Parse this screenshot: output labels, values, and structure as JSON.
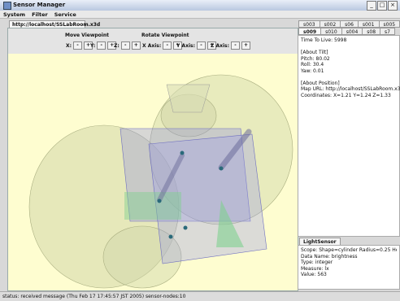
{
  "window": {
    "title": "Sensor Manager",
    "min_label": "_",
    "max_label": "□",
    "close_label": "×"
  },
  "menu": {
    "items": [
      "System",
      "Filter",
      "Service"
    ]
  },
  "viewer_tab": "http://localhost/SSLabRoom.x3d",
  "move_viewpoint": {
    "title": "Move Viewpoint",
    "axes": [
      "X:",
      "Y:",
      "Z:"
    ],
    "minus": "-",
    "plus": "+"
  },
  "rotate_viewpoint": {
    "title": "Rotate Viewpoint",
    "axes": [
      "X Axis:",
      "Y Axis:",
      "Z Axis:"
    ],
    "minus": "-",
    "plus": "+"
  },
  "sensor_tabs_row1": [
    "s003",
    "s002",
    "s06",
    "s001",
    "s005"
  ],
  "sensor_tabs_row2": [
    "s009",
    "s010",
    "s004",
    "s08",
    "s7"
  ],
  "active_sensor_tab": "s009",
  "info": {
    "ttl": "Time To Live: 5998",
    "tilt_header": "[About Tilt]",
    "pitch": "Pitch: 80.02",
    "roll": "Roll: 30.4",
    "yaw": "Yaw: 0.01",
    "position_header": "[About Position]",
    "map_url": "Map URL: http://localhost/SSLabRoom.x3d",
    "coordinates": "Coordinates:  X=1.21 Y=1.24 Z=1.33"
  },
  "light_sensor": {
    "tab": "LightSensor",
    "scope": "Scope: Shape=cylinder Radius=0.25 Height=2.",
    "data_name": "Data Name: brightness",
    "type": "Type: integer",
    "measure": "Measure: lx",
    "value": "Value: 563"
  },
  "status": "status: received message (Thu Feb 17 17:45:57 JST 2005) sensor-nodes:10",
  "colors": {
    "scene_bg": "#fefdd0",
    "sphere": "#c9cfa0",
    "box": "#8f8fe0",
    "panel_green": "#7fd08f"
  }
}
